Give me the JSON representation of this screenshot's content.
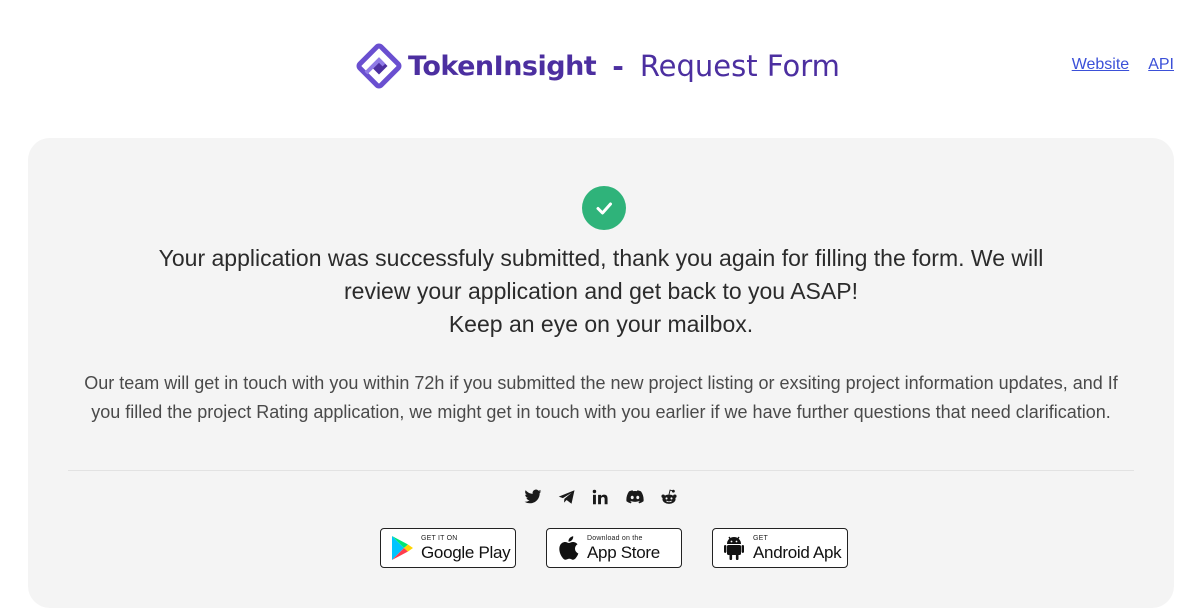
{
  "header": {
    "brand_name": "TokenInsight",
    "separator": "-",
    "subtitle": "Request Form",
    "links": [
      {
        "label": "Website"
      },
      {
        "label": "API"
      }
    ]
  },
  "card": {
    "headline_lines": [
      "Your application was successfuly submitted, thank you again for filling the form. We will",
      "review your application and get back to you ASAP!",
      "Keep an eye on your mailbox."
    ],
    "detail": "Our team will get in touch with you within 72h if you submitted the new project listing or exsiting project information updates, and If you filled the project Rating application, we might get in touch with you earlier if we have further questions that need clarification.",
    "socials": [
      "twitter-icon",
      "telegram-icon",
      "linkedin-icon",
      "discord-icon",
      "reddit-icon"
    ],
    "stores": [
      {
        "small": "GET IT ON",
        "big": "Google Play"
      },
      {
        "small": "Download on the",
        "big": "App Store"
      },
      {
        "small": "GET",
        "big": "Android Apk"
      }
    ]
  },
  "colors": {
    "brand": "#4c2fa0",
    "link": "#3b50d8",
    "success": "#2fb37a",
    "card_bg": "#f4f4f4"
  }
}
